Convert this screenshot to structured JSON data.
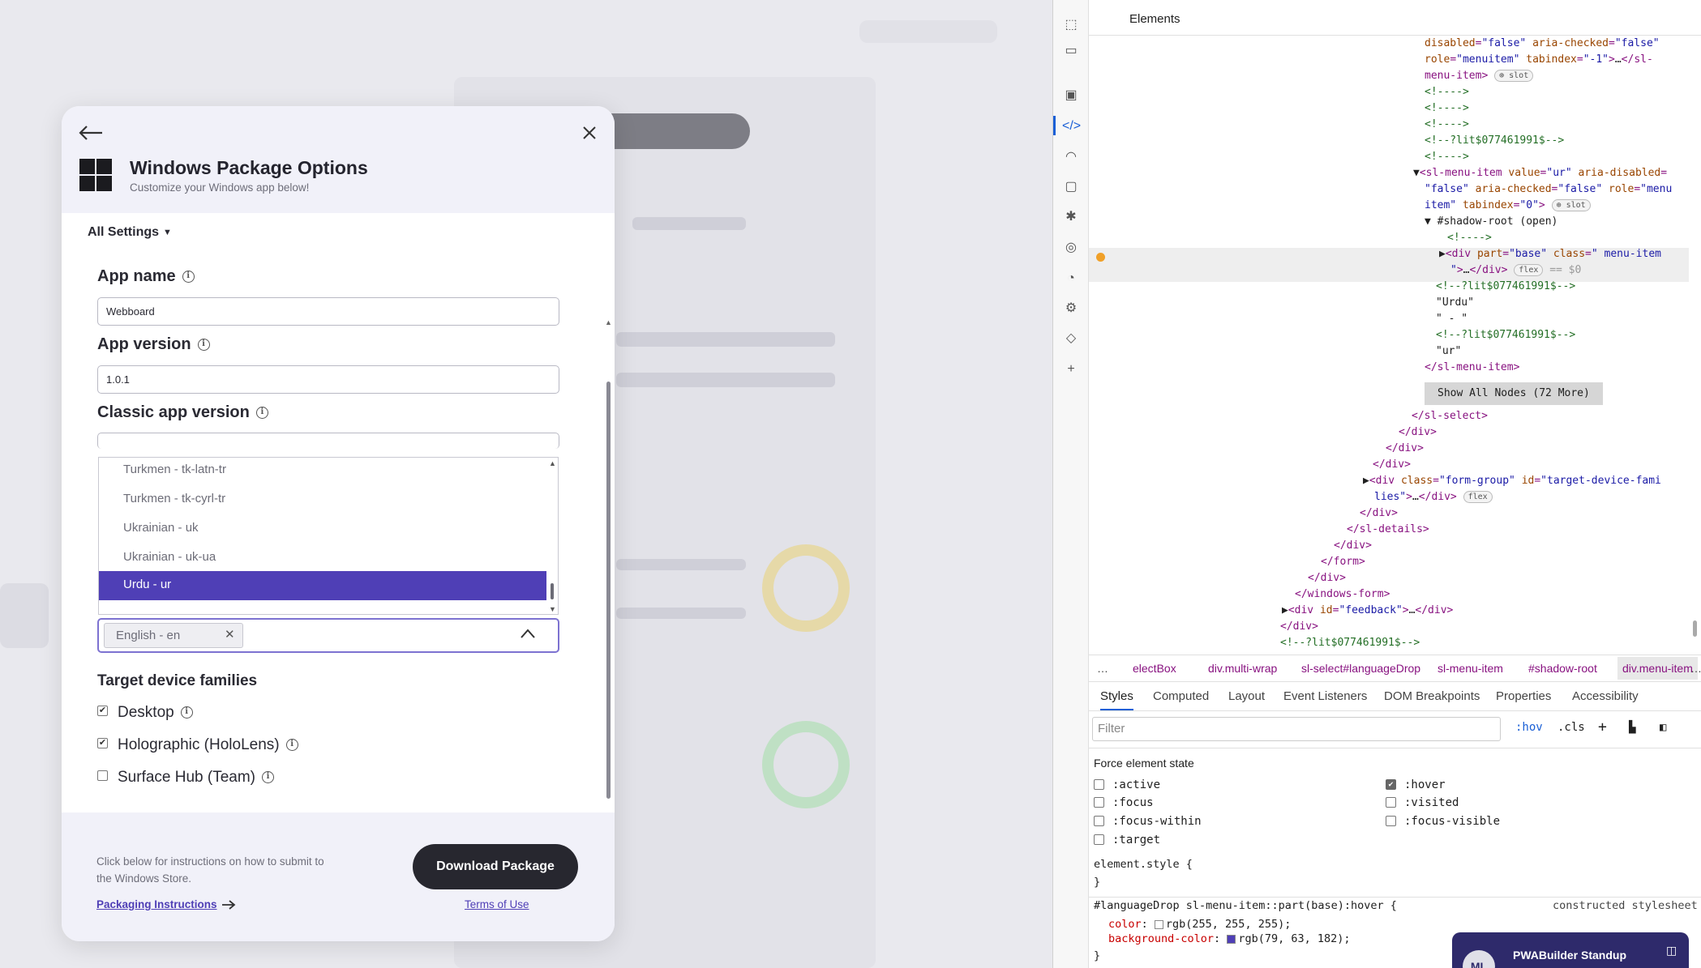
{
  "modal": {
    "title": "Windows Package Options",
    "subtitle": "Customize your Windows app below!",
    "all_settings": "All Settings",
    "app_name_label": "App name",
    "app_name_value": "Webboard",
    "app_version_label": "App version",
    "app_version_value": "1.0.1",
    "classic_version_label": "Classic app version",
    "language_options": [
      "Turkmen - tk-latn-tr",
      "Turkmen - tk-cyrl-tr",
      "Ukrainian - uk",
      "Ukrainian - uk-ua",
      "Urdu - ur"
    ],
    "selected_language_option": "Urdu - ur",
    "language_tag": "English - en",
    "target_device_label": "Target device families",
    "devices": [
      {
        "label": "Desktop",
        "checked": true
      },
      {
        "label": "Holographic (HoloLens)",
        "checked": true
      },
      {
        "label": "Surface Hub (Team)",
        "checked": false
      }
    ],
    "footer_text": "Click below for instructions on how to submit to the Windows Store.",
    "packaging_link": "Packaging Instructions",
    "terms_link": "Terms of Use",
    "download_button": "Download Package",
    "accent_color": "#4f3fb6"
  },
  "devtools": {
    "title": "Elements",
    "show_all_nodes": "Show All Nodes (72 More)",
    "breadcrumbs": [
      "…",
      "electBox",
      "div.multi-wrap",
      "sl-select#languageDrop",
      "sl-menu-item",
      "#shadow-root",
      "div.menu-item",
      "…"
    ],
    "tabs": [
      "Styles",
      "Computed",
      "Layout",
      "Event Listeners",
      "DOM Breakpoints",
      "Properties",
      "Accessibility"
    ],
    "filter_placeholder": "Filter",
    "hov_label": ":hov",
    "cls_label": ".cls",
    "force_state_title": "Force element state",
    "states_left": [
      ":active",
      ":focus",
      ":focus-within",
      ":target"
    ],
    "states_right": [
      ":hover",
      ":visited",
      ":focus-visible"
    ],
    "hover_checked": true,
    "element_style": "element.style {",
    "close_brace": "}",
    "rule_selector": "#languageDrop sl-menu-item::part(base):hover {",
    "rule_source": "constructed stylesheet",
    "color_prop": "color",
    "color_value": "rgb(255, 255, 255);",
    "bg_prop": "background-color",
    "bg_value": "rgb(79, 63, 182);",
    "color_swatch": "#ffffff",
    "bg_swatch": "#4f3fb6"
  },
  "toast": {
    "avatar": "ML",
    "title": "PWABuilder Standup"
  }
}
